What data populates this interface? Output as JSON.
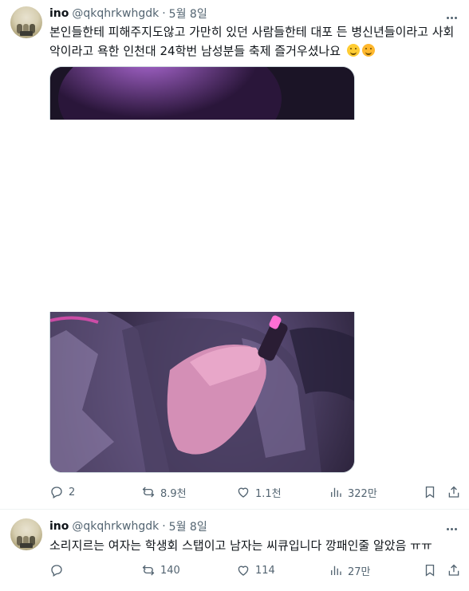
{
  "tweets": [
    {
      "name": "ino",
      "handle": "@qkqhrkwhgdk",
      "date": "5월 8일",
      "text": "본인들한테 피해주지도않고 가만히 있던 사람들한테 대포 든 병신년들이라고 사회악이라고 욕한 인천대 24학번 남성분들 축제 즐거우셨나요",
      "emojis": [
        "grinning-squinting-face-emoji",
        "face-with-hand-over-mouth-emoji"
      ],
      "stats": {
        "replies": "2",
        "reposts": "8.9천",
        "likes": "1.1천",
        "views": "322만"
      }
    },
    {
      "name": "ino",
      "handle": "@qkqhrkwhgdk",
      "date": "5월 8일",
      "text": "소리지르는 여자는 학생회 스탭이고 남자는 씨큐입니다 깡패인줄 알았음 ㅠㅠ",
      "stats": {
        "replies": "",
        "reposts": "140",
        "likes": "114",
        "views": "27만"
      }
    }
  ],
  "separator": "·",
  "colors": {
    "text": "#0f1419",
    "secondary": "#536471",
    "border": "#eff3f4",
    "media_tint": "#7b3fb0"
  }
}
